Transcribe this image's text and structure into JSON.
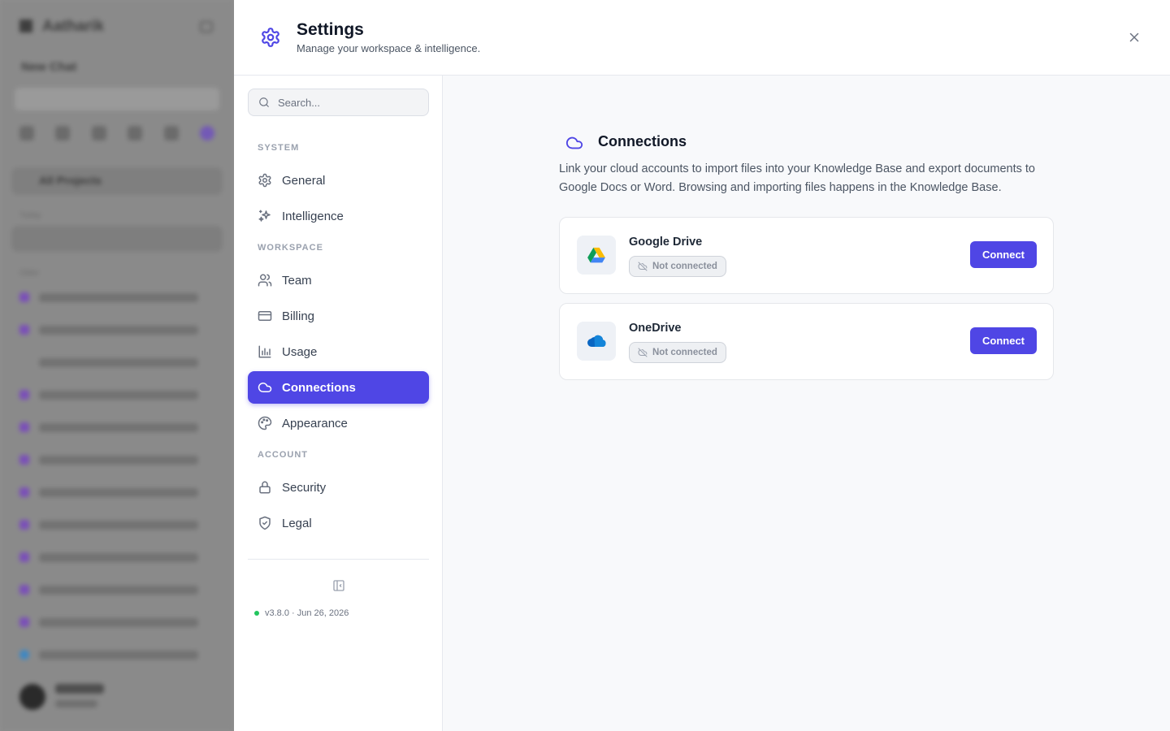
{
  "background_app": {
    "brand": "Aatharik",
    "new_chat": "New Chat",
    "projects": "All Projects",
    "section_today": "Today",
    "section_older": "Older"
  },
  "header": {
    "title": "Settings",
    "subtitle": "Manage your workspace & intelligence."
  },
  "search": {
    "placeholder": "Search..."
  },
  "nav": {
    "sections": [
      {
        "label": "SYSTEM"
      },
      {
        "label": "WORKSPACE"
      },
      {
        "label": "ACCOUNT"
      }
    ],
    "items": [
      {
        "label": "General",
        "icon": "gear-icon"
      },
      {
        "label": "Intelligence",
        "icon": "sparkles-icon"
      },
      {
        "label": "Team",
        "icon": "users-icon"
      },
      {
        "label": "Billing",
        "icon": "credit-card-icon"
      },
      {
        "label": "Usage",
        "icon": "bar-chart-icon"
      },
      {
        "label": "Connections",
        "icon": "cloud-icon",
        "active": true
      },
      {
        "label": "Appearance",
        "icon": "palette-icon"
      },
      {
        "label": "Security",
        "icon": "lock-icon"
      },
      {
        "label": "Legal",
        "icon": "shield-icon"
      }
    ],
    "version": "v3.8.0 · Jun 26, 2026"
  },
  "content": {
    "title": "Connections",
    "description": "Link your cloud accounts to import files into your Knowledge Base and export documents to Google Docs or Word. Browsing and importing files happens in the Knowledge Base.",
    "services": [
      {
        "name": "Google Drive",
        "status": "Not connected",
        "action": "Connect",
        "icon": "google-drive-icon"
      },
      {
        "name": "OneDrive",
        "status": "Not connected",
        "action": "Connect",
        "icon": "onedrive-icon"
      }
    ]
  },
  "colors": {
    "accent": "#4f46e5",
    "status_online": "#22c55e"
  }
}
